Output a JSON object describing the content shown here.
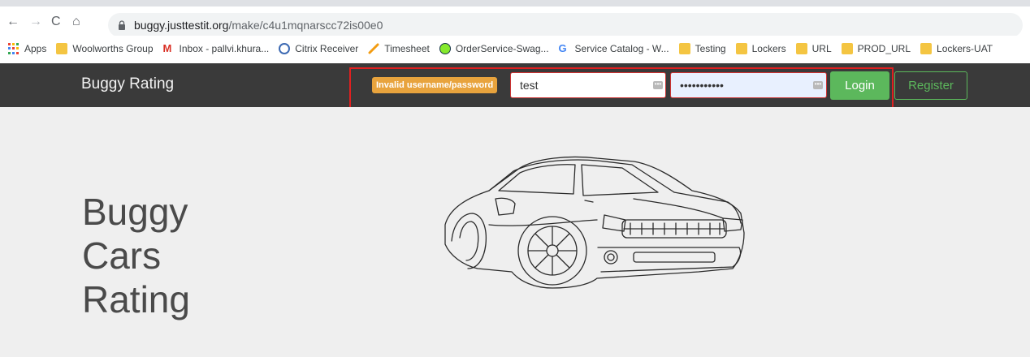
{
  "browser": {
    "url_host": "buggy.justtestit.org",
    "url_path": "/make/c4u1mqnarscc72is00e0",
    "bookmarks": [
      {
        "label": "Apps",
        "icon": "apps-grid-icon"
      },
      {
        "label": "Woolworths Group",
        "icon": "folder-icon"
      },
      {
        "label": "Inbox - pallvi.khura...",
        "icon": "gmail-icon"
      },
      {
        "label": "Citrix Receiver",
        "icon": "citrix-icon"
      },
      {
        "label": "Timesheet",
        "icon": "pen-icon"
      },
      {
        "label": "OrderService-Swag...",
        "icon": "swagger-icon"
      },
      {
        "label": "Service Catalog - W...",
        "icon": "google-icon"
      },
      {
        "label": "Testing",
        "icon": "folder-icon"
      },
      {
        "label": "Lockers",
        "icon": "folder-icon"
      },
      {
        "label": "URL",
        "icon": "folder-icon"
      },
      {
        "label": "PROD_URL",
        "icon": "folder-icon"
      },
      {
        "label": "Lockers-UAT",
        "icon": "folder-icon"
      }
    ]
  },
  "navbar": {
    "brand": "Buggy Rating",
    "error": "Invalid username/password",
    "username_value": "test",
    "password_value": "•••••••••••",
    "login_label": "Login",
    "register_label": "Register"
  },
  "hero": {
    "title_lines": [
      "Buggy",
      "Cars",
      "Rating"
    ]
  },
  "colors": {
    "navbar_bg": "#3a3a3a",
    "success": "#5cb85c",
    "warning": "#e8a33d",
    "highlight": "#e02020",
    "hero_bg": "#efefef"
  }
}
